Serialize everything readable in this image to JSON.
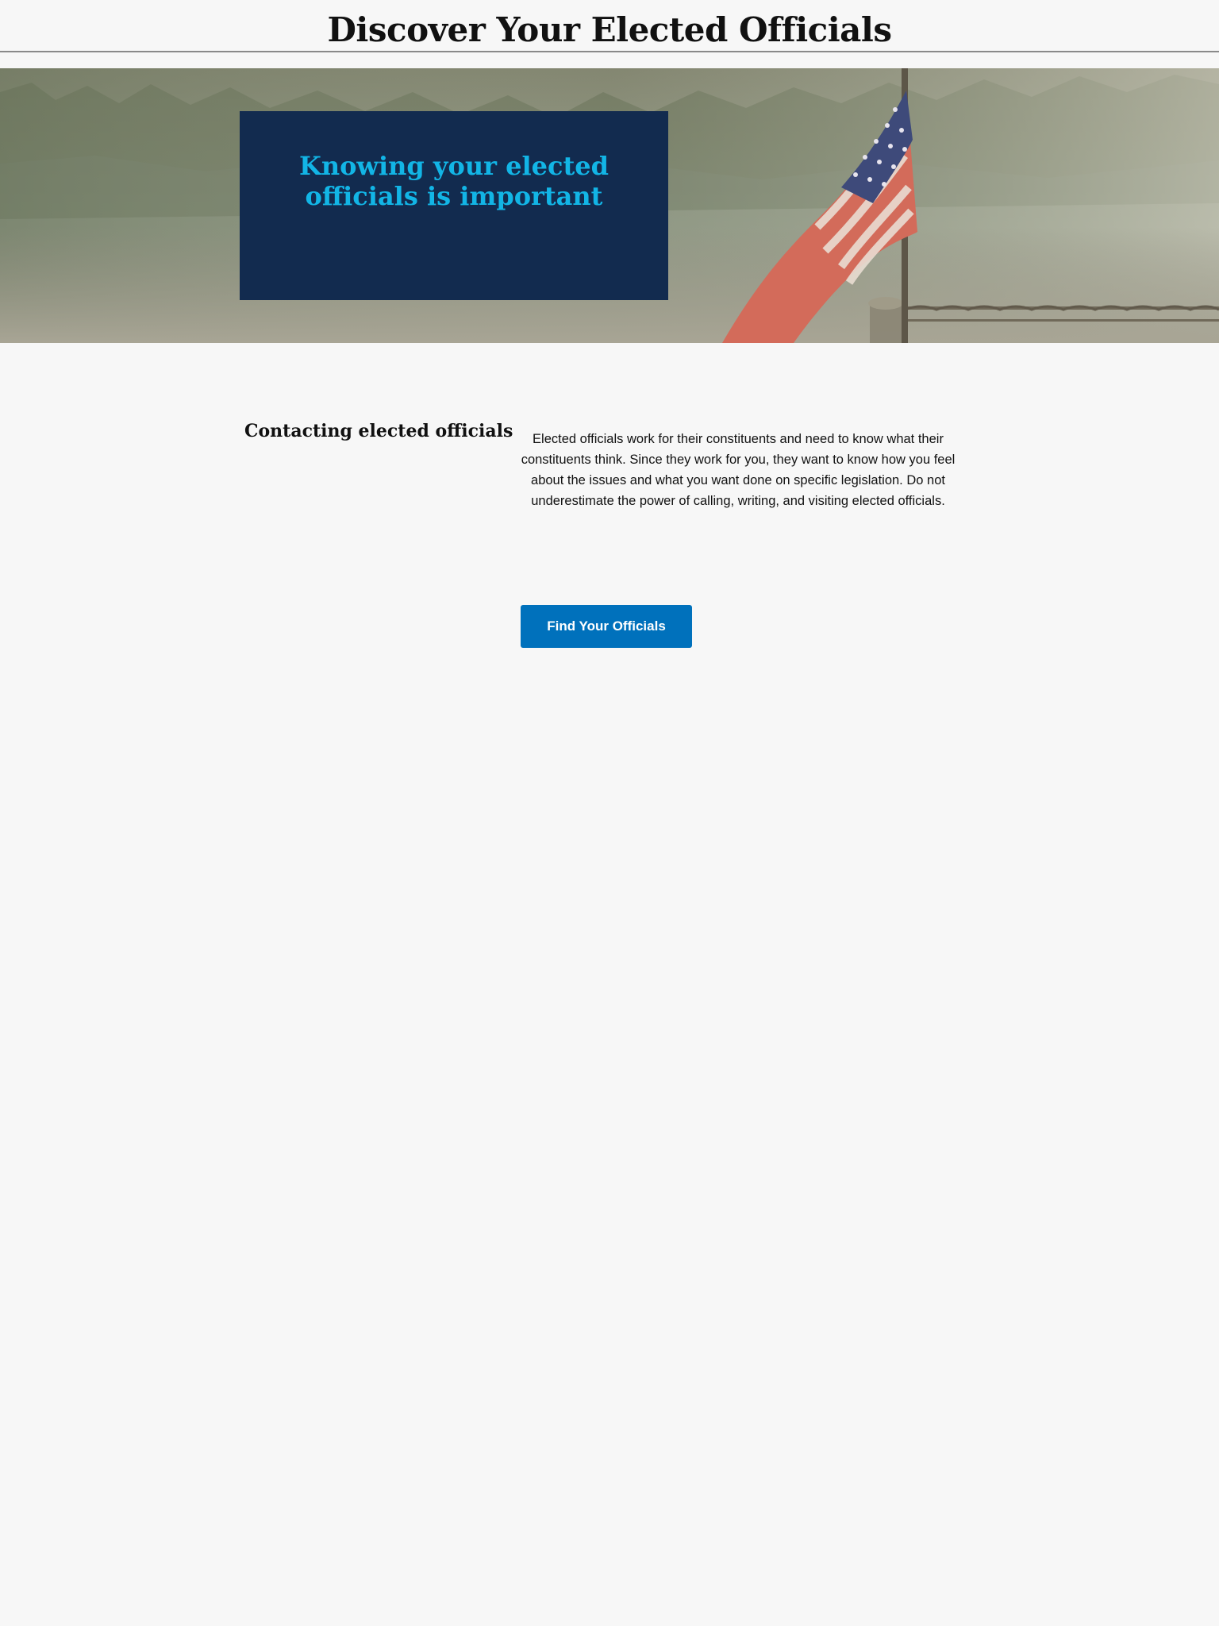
{
  "header": {
    "title": "Discover Your Elected Officials"
  },
  "hero": {
    "heading": "Knowing your elected officials is important",
    "card_color": "#122b4f",
    "heading_color": "#12b5e6"
  },
  "contact_section": {
    "heading": "Contacting elected officials",
    "body": "Elected officials work for their constituents and need to know what their constituents think. Since they work for you, they want to know how you feel about the issues and what you want done on specific legislation. Do not underestimate the power of calling, writing, and visiting elected officials."
  },
  "cta": {
    "label": "Find Your Officials",
    "color": "#0071bc"
  }
}
